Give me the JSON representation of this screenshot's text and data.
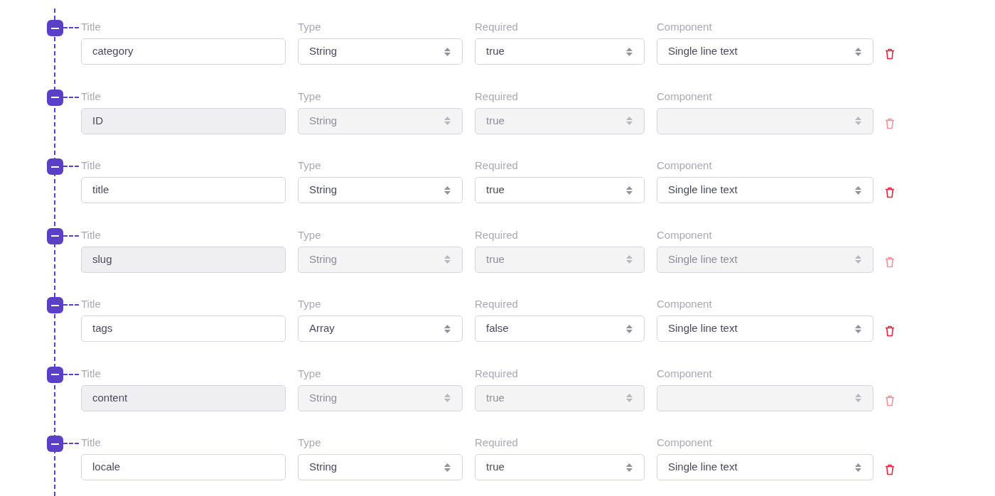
{
  "fields": [
    {
      "title_label": "Title",
      "title": "category",
      "type_label": "Type",
      "type": "String",
      "required_label": "Required",
      "required": "true",
      "component_label": "Component",
      "component": "Single line text",
      "disabled": false
    },
    {
      "title_label": "Title",
      "title": "ID",
      "type_label": "Type",
      "type": "String",
      "required_label": "Required",
      "required": "true",
      "component_label": "Component",
      "disabled": true
    },
    {
      "title_label": "Title",
      "title": "title",
      "type_label": "Type",
      "type": "String",
      "required_label": "Required",
      "required": "true",
      "component_label": "Component",
      "component": "Single line text",
      "disabled": false
    },
    {
      "title_label": "Title",
      "title": "slug",
      "type_label": "Type",
      "type": "String",
      "required_label": "Required",
      "required": "true",
      "component_label": "Component",
      "component": "Single line text",
      "disabled": true
    },
    {
      "title_label": "Title",
      "title": "tags",
      "type_label": "Type",
      "type": "Array",
      "required_label": "Required",
      "required": "false",
      "component_label": "Component",
      "component": "Single line text",
      "disabled": false
    },
    {
      "title_label": "Title",
      "title": "content",
      "type_label": "Type",
      "type": "String",
      "required_label": "Required",
      "required": "true",
      "component_label": "Component",
      "disabled": true
    },
    {
      "title_label": "Title",
      "title": "locale",
      "type_label": "Type",
      "type": "String",
      "required_label": "Required",
      "required": "true",
      "component_label": "Component",
      "component": "Single line text",
      "disabled": false
    }
  ]
}
